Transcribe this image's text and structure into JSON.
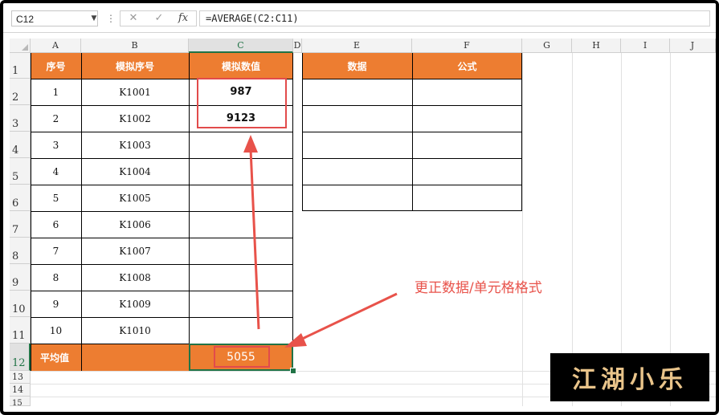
{
  "formula_bar": {
    "name_box": "C12",
    "name_box_arrow_icon": "dropdown-arrow",
    "cancel_symbol": "✕",
    "enter_symbol": "✓",
    "fx_label": "fx",
    "formula": "=AVERAGE(C2:C11)"
  },
  "columns": [
    "A",
    "B",
    "C",
    "D",
    "E",
    "F",
    "G",
    "H",
    "I",
    "J"
  ],
  "rows": [
    "1",
    "2",
    "3",
    "4",
    "5",
    "6",
    "7",
    "8",
    "9",
    "10",
    "11",
    "12",
    "13",
    "14",
    "15"
  ],
  "table": {
    "headers": [
      "序号",
      "模拟序号",
      "模拟数值"
    ],
    "ids": [
      "1",
      "2",
      "3",
      "4",
      "5",
      "6",
      "7",
      "8",
      "9",
      "10"
    ],
    "codes": [
      "K1001",
      "K1002",
      "K1003",
      "K1004",
      "K1005",
      "K1006",
      "K1007",
      "K1008",
      "K1009",
      "K1010"
    ],
    "values": [
      "987",
      "9123",
      "",
      "",
      "",
      "",
      "",
      "",
      "",
      ""
    ],
    "avg_label": "平均值",
    "avg_value": "5055"
  },
  "right_table": {
    "headers": [
      "数据",
      "公式"
    ]
  },
  "annotation": "更正数据/单元格格式",
  "logo_text": "江湖小乐",
  "colors": {
    "header_fill": "#ed7d31",
    "highlight_red": "#e24b4b",
    "selection_green": "#217346"
  }
}
